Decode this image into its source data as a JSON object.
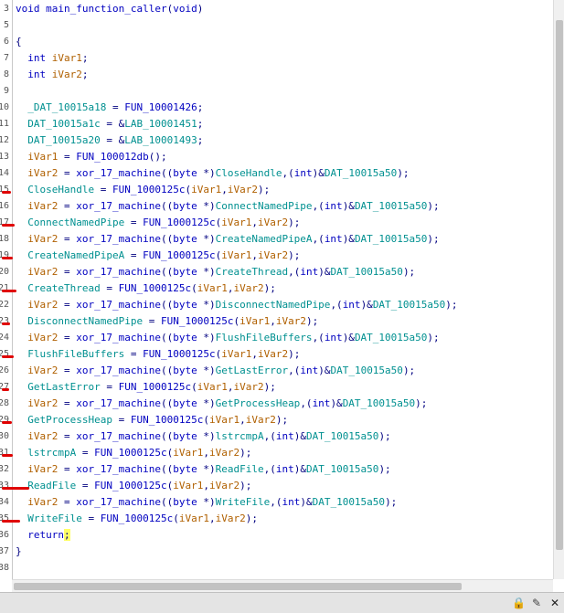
{
  "code_lines": [
    {
      "ln": "3",
      "segs": [
        [
          "kw",
          "void "
        ],
        [
          "func",
          "main_function_caller"
        ],
        [
          "plain",
          "("
        ],
        [
          "kw",
          "void"
        ],
        [
          "plain",
          ")"
        ]
      ]
    },
    {
      "ln": "5",
      "segs": []
    },
    {
      "ln": "6",
      "segs": [
        [
          "plain",
          "{"
        ]
      ]
    },
    {
      "ln": "7",
      "segs": [
        [
          "plain",
          "  "
        ],
        [
          "kw",
          "int "
        ],
        [
          "var",
          "iVar1"
        ],
        [
          "plain",
          ";"
        ]
      ]
    },
    {
      "ln": "8",
      "segs": [
        [
          "plain",
          "  "
        ],
        [
          "kw",
          "int "
        ],
        [
          "var",
          "iVar2"
        ],
        [
          "plain",
          ";"
        ]
      ]
    },
    {
      "ln": "9",
      "segs": []
    },
    {
      "ln": "10",
      "segs": [
        [
          "plain",
          "  "
        ],
        [
          "gdat",
          "_DAT_10015a18"
        ],
        [
          "plain",
          " = "
        ],
        [
          "func",
          "FUN_10001426"
        ],
        [
          "plain",
          ";"
        ]
      ]
    },
    {
      "ln": "11",
      "segs": [
        [
          "plain",
          "  "
        ],
        [
          "gdat",
          "DAT_10015a1c"
        ],
        [
          "plain",
          " = &"
        ],
        [
          "gdat",
          "LAB_10001451"
        ],
        [
          "plain",
          ";"
        ]
      ]
    },
    {
      "ln": "12",
      "segs": [
        [
          "plain",
          "  "
        ],
        [
          "gdat",
          "DAT_10015a20"
        ],
        [
          "plain",
          " = &"
        ],
        [
          "gdat",
          "LAB_10001493"
        ],
        [
          "plain",
          ";"
        ]
      ]
    },
    {
      "ln": "13",
      "segs": [
        [
          "plain",
          "  "
        ],
        [
          "var",
          "iVar1"
        ],
        [
          "plain",
          " = "
        ],
        [
          "func",
          "FUN_100012db"
        ],
        [
          "plain",
          "();"
        ]
      ]
    },
    {
      "ln": "14",
      "segs": [
        [
          "plain",
          "  "
        ],
        [
          "var",
          "iVar2"
        ],
        [
          "plain",
          " = "
        ],
        [
          "func",
          "xor_17_machine"
        ],
        [
          "plain",
          "(("
        ],
        [
          "kw",
          "byte "
        ],
        [
          "plain",
          "*)"
        ],
        [
          "gdat",
          "CloseHandle"
        ],
        [
          "plain",
          ",("
        ],
        [
          "kw",
          "int"
        ],
        [
          "plain",
          ")&"
        ],
        [
          "gdat",
          "DAT_10015a50"
        ],
        [
          "plain",
          ");"
        ]
      ]
    },
    {
      "ln": "15",
      "segs": [
        [
          "plain",
          "  "
        ],
        [
          "gdat",
          "CloseHandle"
        ],
        [
          "plain",
          " = "
        ],
        [
          "func",
          "FUN_1000125c"
        ],
        [
          "plain",
          "("
        ],
        [
          "var",
          "iVar1"
        ],
        [
          "plain",
          ","
        ],
        [
          "var",
          "iVar2"
        ],
        [
          "plain",
          ");"
        ]
      ]
    },
    {
      "ln": "16",
      "segs": [
        [
          "plain",
          "  "
        ],
        [
          "var",
          "iVar2"
        ],
        [
          "plain",
          " = "
        ],
        [
          "func",
          "xor_17_machine"
        ],
        [
          "plain",
          "(("
        ],
        [
          "kw",
          "byte "
        ],
        [
          "plain",
          "*)"
        ],
        [
          "gdat",
          "ConnectNamedPipe"
        ],
        [
          "plain",
          ",("
        ],
        [
          "kw",
          "int"
        ],
        [
          "plain",
          ")&"
        ],
        [
          "gdat",
          "DAT_10015a50"
        ],
        [
          "plain",
          ");"
        ]
      ]
    },
    {
      "ln": "17",
      "segs": [
        [
          "plain",
          "  "
        ],
        [
          "gdat",
          "ConnectNamedPipe"
        ],
        [
          "plain",
          " = "
        ],
        [
          "func",
          "FUN_1000125c"
        ],
        [
          "plain",
          "("
        ],
        [
          "var",
          "iVar1"
        ],
        [
          "plain",
          ","
        ],
        [
          "var",
          "iVar2"
        ],
        [
          "plain",
          ");"
        ]
      ]
    },
    {
      "ln": "18",
      "segs": [
        [
          "plain",
          "  "
        ],
        [
          "var",
          "iVar2"
        ],
        [
          "plain",
          " = "
        ],
        [
          "func",
          "xor_17_machine"
        ],
        [
          "plain",
          "(("
        ],
        [
          "kw",
          "byte "
        ],
        [
          "plain",
          "*)"
        ],
        [
          "gdat",
          "CreateNamedPipeA"
        ],
        [
          "plain",
          ",("
        ],
        [
          "kw",
          "int"
        ],
        [
          "plain",
          ")&"
        ],
        [
          "gdat",
          "DAT_10015a50"
        ],
        [
          "plain",
          ");"
        ]
      ]
    },
    {
      "ln": "19",
      "segs": [
        [
          "plain",
          "  "
        ],
        [
          "gdat",
          "CreateNamedPipeA"
        ],
        [
          "plain",
          " = "
        ],
        [
          "func",
          "FUN_1000125c"
        ],
        [
          "plain",
          "("
        ],
        [
          "var",
          "iVar1"
        ],
        [
          "plain",
          ","
        ],
        [
          "var",
          "iVar2"
        ],
        [
          "plain",
          ");"
        ]
      ]
    },
    {
      "ln": "20",
      "segs": [
        [
          "plain",
          "  "
        ],
        [
          "var",
          "iVar2"
        ],
        [
          "plain",
          " = "
        ],
        [
          "func",
          "xor_17_machine"
        ],
        [
          "plain",
          "(("
        ],
        [
          "kw",
          "byte "
        ],
        [
          "plain",
          "*)"
        ],
        [
          "gdat",
          "CreateThread"
        ],
        [
          "plain",
          ",("
        ],
        [
          "kw",
          "int"
        ],
        [
          "plain",
          ")&"
        ],
        [
          "gdat",
          "DAT_10015a50"
        ],
        [
          "plain",
          ");"
        ]
      ]
    },
    {
      "ln": "21",
      "segs": [
        [
          "plain",
          "  "
        ],
        [
          "gdat",
          "CreateThread"
        ],
        [
          "plain",
          " = "
        ],
        [
          "func",
          "FUN_1000125c"
        ],
        [
          "plain",
          "("
        ],
        [
          "var",
          "iVar1"
        ],
        [
          "plain",
          ","
        ],
        [
          "var",
          "iVar2"
        ],
        [
          "plain",
          ");"
        ]
      ]
    },
    {
      "ln": "22",
      "segs": [
        [
          "plain",
          "  "
        ],
        [
          "var",
          "iVar2"
        ],
        [
          "plain",
          " = "
        ],
        [
          "func",
          "xor_17_machine"
        ],
        [
          "plain",
          "(("
        ],
        [
          "kw",
          "byte "
        ],
        [
          "plain",
          "*)"
        ],
        [
          "gdat",
          "DisconnectNamedPipe"
        ],
        [
          "plain",
          ",("
        ],
        [
          "kw",
          "int"
        ],
        [
          "plain",
          ")&"
        ],
        [
          "gdat",
          "DAT_10015a50"
        ],
        [
          "plain",
          ");"
        ]
      ]
    },
    {
      "ln": "23",
      "segs": [
        [
          "plain",
          "  "
        ],
        [
          "gdat",
          "DisconnectNamedPipe"
        ],
        [
          "plain",
          " = "
        ],
        [
          "func",
          "FUN_1000125c"
        ],
        [
          "plain",
          "("
        ],
        [
          "var",
          "iVar1"
        ],
        [
          "plain",
          ","
        ],
        [
          "var",
          "iVar2"
        ],
        [
          "plain",
          ");"
        ]
      ]
    },
    {
      "ln": "24",
      "segs": [
        [
          "plain",
          "  "
        ],
        [
          "var",
          "iVar2"
        ],
        [
          "plain",
          " = "
        ],
        [
          "func",
          "xor_17_machine"
        ],
        [
          "plain",
          "(("
        ],
        [
          "kw",
          "byte "
        ],
        [
          "plain",
          "*)"
        ],
        [
          "gdat",
          "FlushFileBuffers"
        ],
        [
          "plain",
          ",("
        ],
        [
          "kw",
          "int"
        ],
        [
          "plain",
          ")&"
        ],
        [
          "gdat",
          "DAT_10015a50"
        ],
        [
          "plain",
          ");"
        ]
      ]
    },
    {
      "ln": "25",
      "segs": [
        [
          "plain",
          "  "
        ],
        [
          "gdat",
          "FlushFileBuffers"
        ],
        [
          "plain",
          " = "
        ],
        [
          "func",
          "FUN_1000125c"
        ],
        [
          "plain",
          "("
        ],
        [
          "var",
          "iVar1"
        ],
        [
          "plain",
          ","
        ],
        [
          "var",
          "iVar2"
        ],
        [
          "plain",
          ");"
        ]
      ]
    },
    {
      "ln": "26",
      "segs": [
        [
          "plain",
          "  "
        ],
        [
          "var",
          "iVar2"
        ],
        [
          "plain",
          " = "
        ],
        [
          "func",
          "xor_17_machine"
        ],
        [
          "plain",
          "(("
        ],
        [
          "kw",
          "byte "
        ],
        [
          "plain",
          "*)"
        ],
        [
          "gdat",
          "GetLastError"
        ],
        [
          "plain",
          ",("
        ],
        [
          "kw",
          "int"
        ],
        [
          "plain",
          ")&"
        ],
        [
          "gdat",
          "DAT_10015a50"
        ],
        [
          "plain",
          ");"
        ]
      ]
    },
    {
      "ln": "27",
      "segs": [
        [
          "plain",
          "  "
        ],
        [
          "gdat",
          "GetLastError"
        ],
        [
          "plain",
          " = "
        ],
        [
          "func",
          "FUN_1000125c"
        ],
        [
          "plain",
          "("
        ],
        [
          "var",
          "iVar1"
        ],
        [
          "plain",
          ","
        ],
        [
          "var",
          "iVar2"
        ],
        [
          "plain",
          ");"
        ]
      ]
    },
    {
      "ln": "28",
      "segs": [
        [
          "plain",
          "  "
        ],
        [
          "var",
          "iVar2"
        ],
        [
          "plain",
          " = "
        ],
        [
          "func",
          "xor_17_machine"
        ],
        [
          "plain",
          "(("
        ],
        [
          "kw",
          "byte "
        ],
        [
          "plain",
          "*)"
        ],
        [
          "gdat",
          "GetProcessHeap"
        ],
        [
          "plain",
          ",("
        ],
        [
          "kw",
          "int"
        ],
        [
          "plain",
          ")&"
        ],
        [
          "gdat",
          "DAT_10015a50"
        ],
        [
          "plain",
          ");"
        ]
      ]
    },
    {
      "ln": "29",
      "segs": [
        [
          "plain",
          "  "
        ],
        [
          "gdat",
          "GetProcessHeap"
        ],
        [
          "plain",
          " = "
        ],
        [
          "func",
          "FUN_1000125c"
        ],
        [
          "plain",
          "("
        ],
        [
          "var",
          "iVar1"
        ],
        [
          "plain",
          ","
        ],
        [
          "var",
          "iVar2"
        ],
        [
          "plain",
          ");"
        ]
      ]
    },
    {
      "ln": "30",
      "segs": [
        [
          "plain",
          "  "
        ],
        [
          "var",
          "iVar2"
        ],
        [
          "plain",
          " = "
        ],
        [
          "func",
          "xor_17_machine"
        ],
        [
          "plain",
          "(("
        ],
        [
          "kw",
          "byte "
        ],
        [
          "plain",
          "*)"
        ],
        [
          "gdat",
          "lstrcmpA"
        ],
        [
          "plain",
          ",("
        ],
        [
          "kw",
          "int"
        ],
        [
          "plain",
          ")&"
        ],
        [
          "gdat",
          "DAT_10015a50"
        ],
        [
          "plain",
          ");"
        ]
      ]
    },
    {
      "ln": "31",
      "segs": [
        [
          "plain",
          "  "
        ],
        [
          "gdat",
          "lstrcmpA"
        ],
        [
          "plain",
          " = "
        ],
        [
          "func",
          "FUN_1000125c"
        ],
        [
          "plain",
          "("
        ],
        [
          "var",
          "iVar1"
        ],
        [
          "plain",
          ","
        ],
        [
          "var",
          "iVar2"
        ],
        [
          "plain",
          ");"
        ]
      ]
    },
    {
      "ln": "32",
      "segs": [
        [
          "plain",
          "  "
        ],
        [
          "var",
          "iVar2"
        ],
        [
          "plain",
          " = "
        ],
        [
          "func",
          "xor_17_machine"
        ],
        [
          "plain",
          "(("
        ],
        [
          "kw",
          "byte "
        ],
        [
          "plain",
          "*)"
        ],
        [
          "gdat",
          "ReadFile"
        ],
        [
          "plain",
          ",("
        ],
        [
          "kw",
          "int"
        ],
        [
          "plain",
          ")&"
        ],
        [
          "gdat",
          "DAT_10015a50"
        ],
        [
          "plain",
          ");"
        ]
      ]
    },
    {
      "ln": "33",
      "segs": [
        [
          "plain",
          "  "
        ],
        [
          "gdat",
          "ReadFile"
        ],
        [
          "plain",
          " = "
        ],
        [
          "func",
          "FUN_1000125c"
        ],
        [
          "plain",
          "("
        ],
        [
          "var",
          "iVar1"
        ],
        [
          "plain",
          ","
        ],
        [
          "var",
          "iVar2"
        ],
        [
          "plain",
          ");"
        ]
      ]
    },
    {
      "ln": "34",
      "segs": [
        [
          "plain",
          "  "
        ],
        [
          "var",
          "iVar2"
        ],
        [
          "plain",
          " = "
        ],
        [
          "func",
          "xor_17_machine"
        ],
        [
          "plain",
          "(("
        ],
        [
          "kw",
          "byte "
        ],
        [
          "plain",
          "*)"
        ],
        [
          "gdat",
          "WriteFile"
        ],
        [
          "plain",
          ",("
        ],
        [
          "kw",
          "int"
        ],
        [
          "plain",
          ")&"
        ],
        [
          "gdat",
          "DAT_10015a50"
        ],
        [
          "plain",
          ");"
        ]
      ]
    },
    {
      "ln": "35",
      "segs": [
        [
          "plain",
          "  "
        ],
        [
          "gdat",
          "WriteFile"
        ],
        [
          "plain",
          " = "
        ],
        [
          "func",
          "FUN_1000125c"
        ],
        [
          "plain",
          "("
        ],
        [
          "var",
          "iVar1"
        ],
        [
          "plain",
          ","
        ],
        [
          "var",
          "iVar2"
        ],
        [
          "plain",
          ");"
        ]
      ]
    },
    {
      "ln": "36",
      "segs": [
        [
          "plain",
          "  "
        ],
        [
          "kw",
          "return"
        ],
        [
          "hl",
          ";"
        ]
      ]
    },
    {
      "ln": "37",
      "segs": [
        [
          "plain",
          "}"
        ]
      ]
    },
    {
      "ln": "38",
      "segs": []
    }
  ],
  "status_icons": [
    "lock-icon",
    "edit-icon",
    "close-icon"
  ],
  "colors": {
    "keyword": "#0000c0",
    "variable": "#b06000",
    "global": "#009090",
    "annotation_mark": "#e00000",
    "cursor_highlight": "#ffff66"
  }
}
